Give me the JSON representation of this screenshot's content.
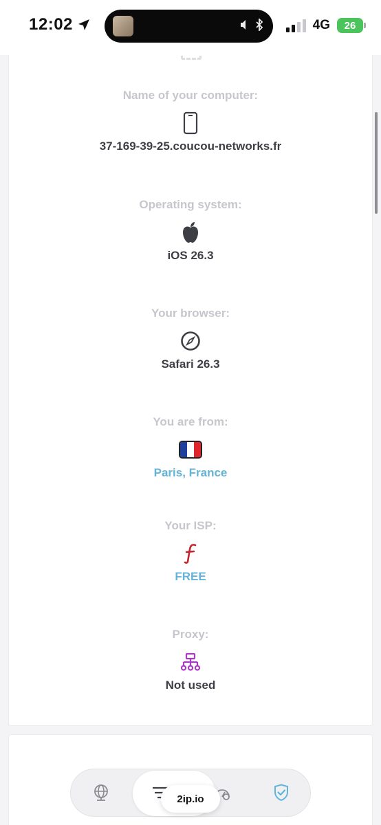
{
  "status_bar": {
    "time": "12:02",
    "network": "4G",
    "battery": "26"
  },
  "items": [
    {
      "label": "Name of your computer:",
      "value": "37-169-39-25.coucou-networks.fr",
      "icon": "phone-icon"
    },
    {
      "label": "Operating system:",
      "value": "iOS 26.3",
      "icon": "apple-icon"
    },
    {
      "label": "Your browser:",
      "value": "Safari 26.3",
      "icon": "compass-icon"
    },
    {
      "label": "You are from:",
      "value": "Paris, France",
      "icon": "france-flag-icon"
    },
    {
      "label": "Your ISP:",
      "value": "FREE",
      "icon": "free-isp-logo-icon"
    },
    {
      "label": "Proxy:",
      "value": "Not used",
      "icon": "network-tree-icon"
    }
  ],
  "nav": {
    "domain": "2ip.io",
    "tabs": [
      "globe-icon",
      "menu-icon",
      "speed-icon",
      "shield-check-icon"
    ]
  },
  "colors": {
    "label": "#c6c7cc",
    "value": "#3e3f45",
    "link": "#64b3d8",
    "isp_red": "#c0262d",
    "proxy_purple": "#a83bc0",
    "shield_blue": "#5fb5d9"
  }
}
